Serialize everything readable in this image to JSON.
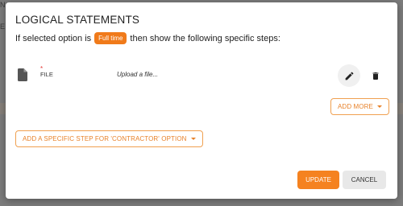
{
  "background": {
    "fragment_1": "N",
    "fragment_2": "E"
  },
  "modal": {
    "title": "LOGICAL STATEMENTS",
    "statement_prefix": "If selected option is",
    "selected_option": "Full time",
    "statement_suffix": "then show the following specific steps:"
  },
  "file_step": {
    "required_marker": "*",
    "label": "FILE",
    "upload_placeholder": "Upload a file..."
  },
  "buttons": {
    "add_more": "ADD MORE",
    "add_specific_step": "ADD A SPECIFIC STEP FOR 'CONTRACTOR' OPTION",
    "update": "UPDATE",
    "cancel": "CANCEL"
  },
  "icons": {
    "file": "document-icon",
    "edit": "pencil-icon",
    "delete": "trash-icon",
    "dropdown": "caret-down-icon"
  },
  "colors": {
    "accent": "#f58220",
    "chip": "#f07a1a",
    "required": "#e53935"
  }
}
